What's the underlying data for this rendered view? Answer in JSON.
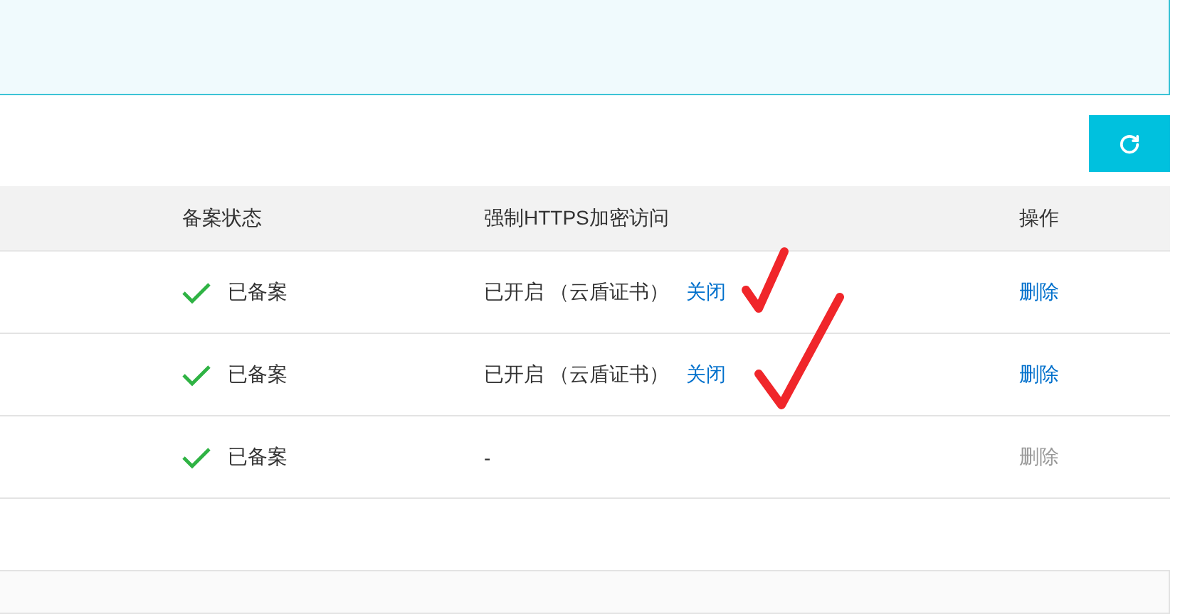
{
  "toolbar": {
    "refresh_button": {
      "kind": "refresh"
    }
  },
  "table": {
    "columns": [
      "备案状态",
      "强制HTTPS加密访问",
      "操作"
    ],
    "rows": [
      {
        "filing_ok": true,
        "filing_status": "已备案",
        "https_status": "已开启 （云盾证书）",
        "https_action": "关闭",
        "delete": "删除",
        "delete_disabled": false
      },
      {
        "filing_ok": true,
        "filing_status": "已备案",
        "https_status": "已开启 （云盾证书）",
        "https_action": "关闭",
        "delete": "删除",
        "delete_disabled": false
      },
      {
        "filing_ok": true,
        "filing_status": "已备案",
        "https_status": "-",
        "delete": "删除",
        "delete_disabled": true
      }
    ]
  },
  "annotations": [
    {
      "kind": "tick"
    },
    {
      "kind": "tick"
    }
  ]
}
